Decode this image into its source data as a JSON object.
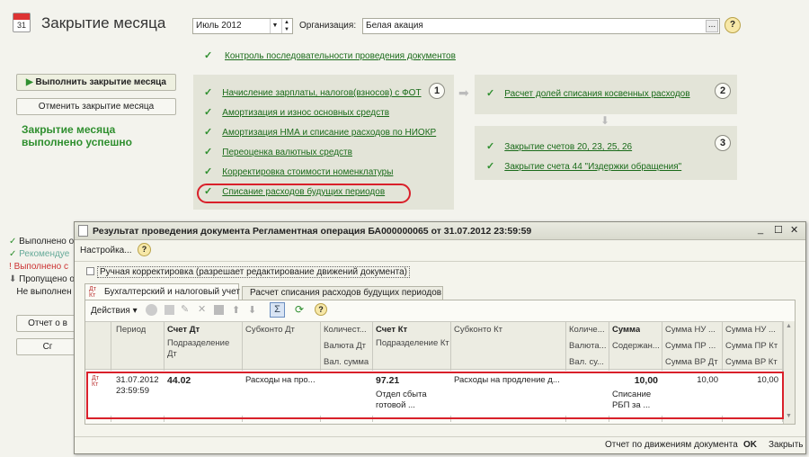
{
  "header": {
    "title": "Закрытие месяца",
    "period": "Июль 2012",
    "org_label": "Организация:",
    "org_value": "Белая акация",
    "help": "?"
  },
  "top_link": "Контроль последовательности проведения документов",
  "left": {
    "run_btn": "Выполнить закрытие месяца",
    "cancel_btn": "Отменить закрытие месяца",
    "success": "Закрытие месяца выполнено успешно",
    "statuses": [
      "Выполнено о",
      "Рекомендуе",
      "Выполнено с",
      "Пропущено о",
      "Не выполнен"
    ],
    "btn_a": "Отчет о в",
    "btn_b": "Сг"
  },
  "step1": {
    "num": "1",
    "items": [
      "Начисление зарплаты, налогов(взносов) с ФОТ",
      "Амортизация и износ основных средств",
      "Амортизация НМА и списание расходов по НИОКР",
      "Переоценка валютных средств",
      "Корректировка стоимости номенклатуры",
      "Списание расходов будущих периодов"
    ]
  },
  "step2": {
    "num": "2",
    "items": [
      "Расчет долей списания косвенных расходов"
    ]
  },
  "step3": {
    "num": "3",
    "items": [
      "Закрытие счетов 20, 23, 25, 26",
      "Закрытие счета 44 \"Издержки обращения\""
    ]
  },
  "dialog": {
    "title": "Результат проведения документа Регламентная операция БА000000065 от 31.07.2012 23:59:59",
    "settings": "Настройка...",
    "help": "?",
    "checkbox": "Ручная корректировка (разрешает редактирование движений документа)",
    "tabs": [
      "Бухгалтерский и налоговый учет",
      "Расчет списания расходов будущих периодов"
    ],
    "actions": "Действия",
    "cols": {
      "period": "Период",
      "dt": "Счет Дт",
      "dt_sub": "Подразделение Дт",
      "subdt": "Субконто Дт",
      "qty": "Количест...",
      "cur": "Валюта Дт",
      "valsum": "Вал. сумма",
      "kt": "Счет Кт",
      "kt_sub": "Подразделение Кт",
      "subkt": "Субконто Кт",
      "qty2": "Количе...",
      "cur2": "Валюта...",
      "valsum2": "Вал. су...",
      "sum": "Сумма",
      "content": "Содержан...",
      "nu": "Сумма НУ ...",
      "pr": "Сумма ПР ...",
      "vr": "Сумма ВР Дт",
      "nu2": "Сумма НУ ...",
      "pr2": "Сумма ПР Кт",
      "vr2": "Сумма ВР Кт"
    },
    "row": {
      "date": "31.07.2012",
      "time": "23:59:59",
      "dt": "44.02",
      "subdt": "Расходы на про...",
      "kt": "97.21",
      "kt_sub1": "Отдел сбыта",
      "kt_sub2": "готовой ...",
      "subkt": "Расходы на продление д...",
      "sum": "10,00",
      "content1": "Списание",
      "content2": "РБП за ...",
      "nu": "10,00",
      "nu2": "10,00"
    },
    "status_report": "Отчет по движениям документа",
    "ok": "OK",
    "close": "Закрыть"
  },
  "colors": {
    "accent_red": "#d9202a",
    "link_green": "#1a6b1a"
  }
}
